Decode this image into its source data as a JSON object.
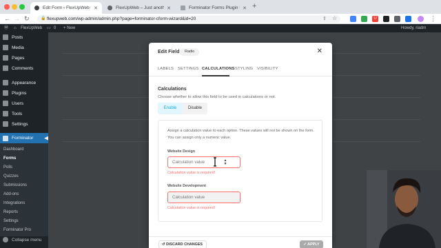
{
  "browser": {
    "tabs": [
      {
        "label": "Edit Form ‹ FlexUpWeb — Wo...",
        "active": true
      },
      {
        "label": "FlexUpWeb – Just another Wo...",
        "active": false
      },
      {
        "label": "Forminator Forms Plugin Usag...",
        "active": false
      }
    ],
    "url": "flexupweb.com/wp-admin/admin.php?page=forminator-cform-wizard&id=20"
  },
  "adminbar": {
    "site": "FlexUpWeb",
    "comments": "0",
    "new": "+ New",
    "howdy": "Howdy, riadm"
  },
  "sidebar": {
    "items": [
      {
        "label": "Posts"
      },
      {
        "label": "Media"
      },
      {
        "label": "Pages"
      },
      {
        "label": "Comments"
      },
      {
        "label": "Appearance"
      },
      {
        "label": "Plugins"
      },
      {
        "label": "Users"
      },
      {
        "label": "Tools"
      },
      {
        "label": "Settings"
      }
    ],
    "active_label": "Forminator",
    "submenu": [
      "Dashboard",
      "Forms",
      "Polls",
      "Quizzes",
      "Submissions",
      "Add-ons",
      "Integrations",
      "Reports",
      "Settings",
      "Forminator Pro"
    ],
    "collapse": "Collapse menu"
  },
  "modal": {
    "title": "Edit Field",
    "badge": "Radio",
    "tabs": [
      "LABELS",
      "SETTINGS",
      "CALCULATIONS",
      "STYLING",
      "VISIBILITY"
    ],
    "active_tab": "CALCULATIONS",
    "section_title": "Calculations",
    "section_desc": "Choose whether to allow this field to be used in calculations or not.",
    "toggle": {
      "enable": "Enable",
      "disable": "Disable"
    },
    "info_line1": "Assign a calculation value to each option. These values will not be shown on the form.",
    "info_line2": "You can assign only a numeric value.",
    "fields": [
      {
        "label": "Website Design",
        "placeholder": "Calculation value",
        "error": "Calculation value is required!"
      },
      {
        "label": "Website Development",
        "placeholder": "Calculation value",
        "error": "Calculation value is required!"
      }
    ],
    "discard": "DISCARD CHANGES",
    "apply": "APPLY"
  },
  "colors": {
    "accent": "#17a8e3",
    "error": "#ff6d6d",
    "wp_active": "#2271b1"
  }
}
